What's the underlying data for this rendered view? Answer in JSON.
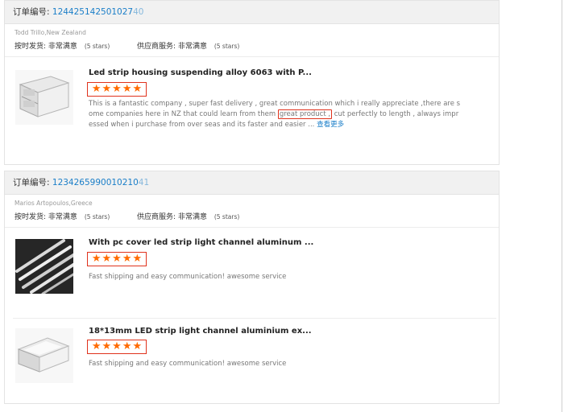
{
  "orders": [
    {
      "order_label": "订单编号:",
      "order_number": "124425142501027",
      "order_number_faded": "40",
      "buyer": "Todd Trillo,New Zealand",
      "on_time_label": "按时发货:",
      "on_time_value": "非常满意",
      "on_time_stars": "(5 stars)",
      "supplier_label": "供应商服务:",
      "supplier_value": "非常满意",
      "supplier_stars": "(5 stars)",
      "products": [
        {
          "title": "Led strip housing suspending alloy 6063 with P...",
          "rating": 5,
          "review_part1": "This is a fantastic company , super fast delivery , great communication which i really appreciate ,there are s ome companies here in NZ that could learn from them",
          "review_highlight": "great product ,",
          "review_part2": "cut perfectly to length , always impr essed when i purchase from over seas and its faster and easier ...",
          "view_more": "查看更多"
        }
      ]
    },
    {
      "order_label": "订单编号:",
      "order_number": "1234265990010210",
      "order_number_faded": "41",
      "buyer": "Marios Artopoulos,Greece",
      "on_time_label": "按时发货:",
      "on_time_value": "非常满意",
      "on_time_stars": "(5 stars)",
      "supplier_label": "供应商服务:",
      "supplier_value": "非常满意",
      "supplier_stars": "(5 stars)",
      "products": [
        {
          "title": "With pc cover led strip light channel aluminum ...",
          "rating": 5,
          "review": "Fast shipping and easy communication! awesome service"
        },
        {
          "title": "18*13mm LED strip light channel aluminium ex...",
          "rating": 5,
          "review": "Fast shipping and easy communication! awesome service"
        }
      ]
    }
  ],
  "colors": {
    "star": "#ff6a00",
    "highlight_box": "#e0321c",
    "link": "#1a7ec8"
  },
  "icons": {
    "star": "star-icon"
  }
}
